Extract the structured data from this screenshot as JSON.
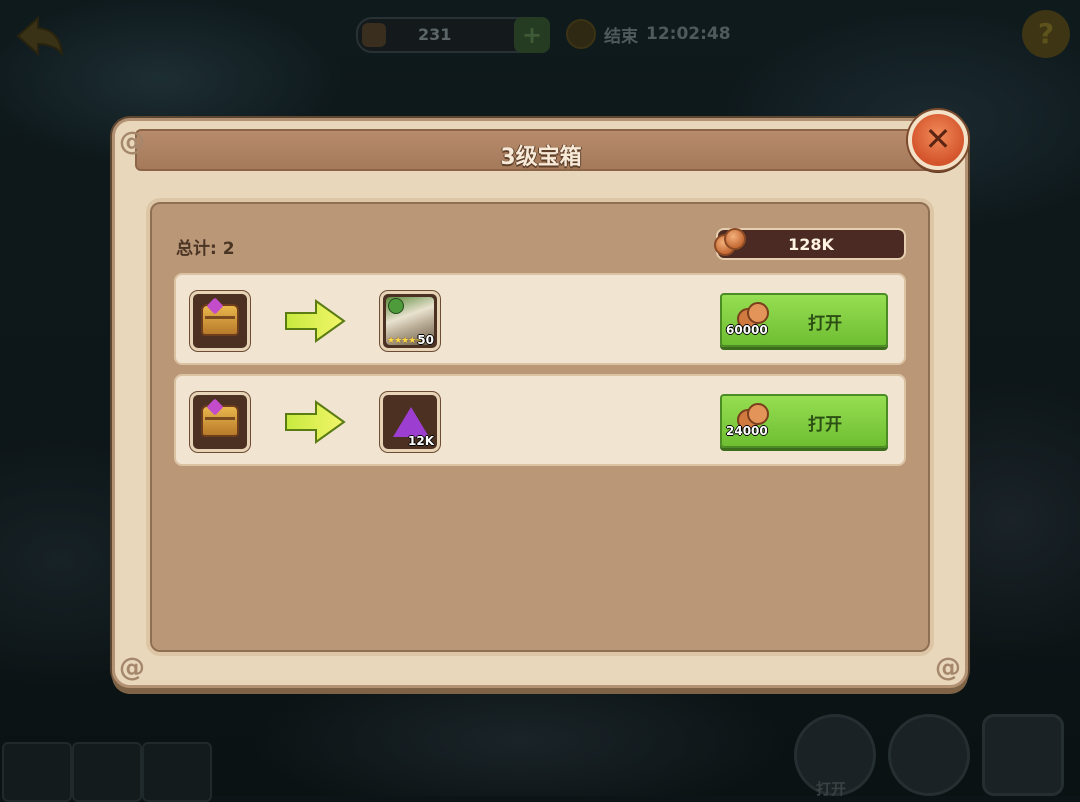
{
  "hud": {
    "resource_value": "231",
    "timer_label": "结束",
    "timer_value": "12:02:48",
    "help_glyph": "?",
    "plus_glyph": "+"
  },
  "dialog": {
    "title": "3级宝箱",
    "close_glyph": "✕",
    "total_label": "总计: 2",
    "currency_amount": "128K",
    "rows": [
      {
        "source_icon": "treasure-chest-icon",
        "reward_icon": "hero-portrait-icon",
        "reward_stars": "★★★★★",
        "reward_level": "50",
        "cost": "60000",
        "button_label": "打开"
      },
      {
        "source_icon": "treasure-chest-icon",
        "reward_icon": "purple-crystal-icon",
        "reward_amount": "12K",
        "cost": "24000",
        "button_label": "打开"
      }
    ]
  },
  "bottom": {
    "button_label": "打开"
  },
  "colors": {
    "dialog_bg": "#e9d7bc",
    "inner_panel": "#ba9777",
    "title_bar": "#a47a5b",
    "open_button": "#84cf42",
    "close_button": "#d4542c"
  }
}
